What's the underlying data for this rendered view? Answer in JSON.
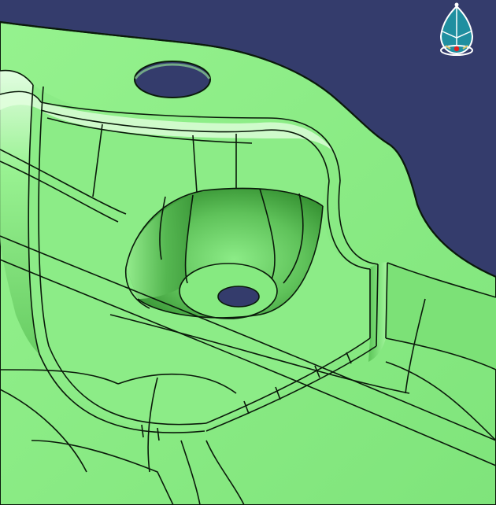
{
  "viewport": {
    "background_color": "#343c6c",
    "part_color": "#86ec82",
    "edge_color": "#0a1a0a"
  },
  "compass": {
    "icon": "compass-icon",
    "colors": {
      "frame": "#ffffff",
      "face": "#1f8fa0",
      "axis_x": "#d8c46a",
      "center": "#e02020"
    }
  }
}
